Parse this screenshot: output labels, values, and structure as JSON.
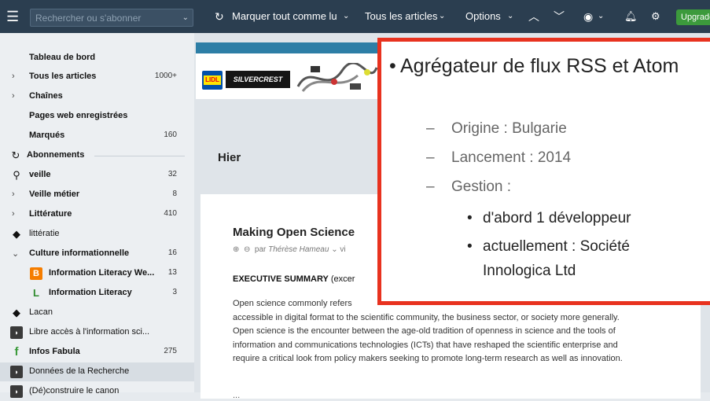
{
  "topbar": {
    "menu_icon": "hamburger-icon",
    "search_placeholder": "Rechercher ou s'abonner",
    "mark_all_label": "Marquer tout comme lu",
    "all_articles_label": "Tous les articles",
    "options_label": "Options",
    "upgrade_label": "Upgrade"
  },
  "sidebar": {
    "items": [
      {
        "label": "Tableau de bord"
      },
      {
        "label": "Tous les articles",
        "count": "1000+"
      },
      {
        "label": "Chaînes"
      },
      {
        "label": "Pages web enregistrées"
      },
      {
        "label": "Marqués",
        "count": "160"
      },
      {
        "label": "Abonnements"
      },
      {
        "label": "veille",
        "count": "32"
      },
      {
        "label": "Veille métier",
        "count": "8"
      },
      {
        "label": "Littérature",
        "count": "410"
      },
      {
        "label": "littératie"
      },
      {
        "label": "Culture informationnelle",
        "count": "16"
      },
      {
        "label": "Information Literacy We...",
        "count": "13"
      },
      {
        "label": "Information Literacy",
        "count": "3"
      },
      {
        "label": "Lacan"
      },
      {
        "label": "Libre accès à l'information sci..."
      },
      {
        "label": "Infos Fabula",
        "count": "275"
      },
      {
        "label": "Données de la Recherche"
      },
      {
        "label": "(Dé)construire le canon"
      }
    ]
  },
  "main": {
    "banner_brand_1": "LIDL",
    "banner_brand_2": "SILVERCREST",
    "section_title": "Hier",
    "article": {
      "title": "Making Open Science",
      "meta_prefix": "par",
      "author": "Thérèse Hameau",
      "meta_suffix": "vi",
      "summary_bold": "EXECUTIVE SUMMARY",
      "summary_rest": " (excer",
      "body_lines": [
        "Open science commonly refers",
        "accessible in digital format to the scientific community, the business sector, or society more generally.",
        "Open science is the encounter between the age-old tradition of openness in science and the tools of",
        "information and communications technologies (ICTs) that have reshaped the scientific enterprise and",
        "require a critical look from policy makers seeking to promote long-term research as well as innovation."
      ],
      "ellipsis": "..."
    }
  },
  "overlay": {
    "main_point": "Agrégateur de flux RSS et Atom",
    "sub_points": [
      "Origine : Bulgarie",
      "Lancement : 2014",
      "Gestion :"
    ],
    "sub_sub_points": [
      "d'abord 1 développeur",
      "actuellement : Société Innologica Ltd"
    ]
  },
  "colors": {
    "topbar": "#2b3e50",
    "accent_border": "#e8321f",
    "upgrade": "#3c9a3c"
  }
}
